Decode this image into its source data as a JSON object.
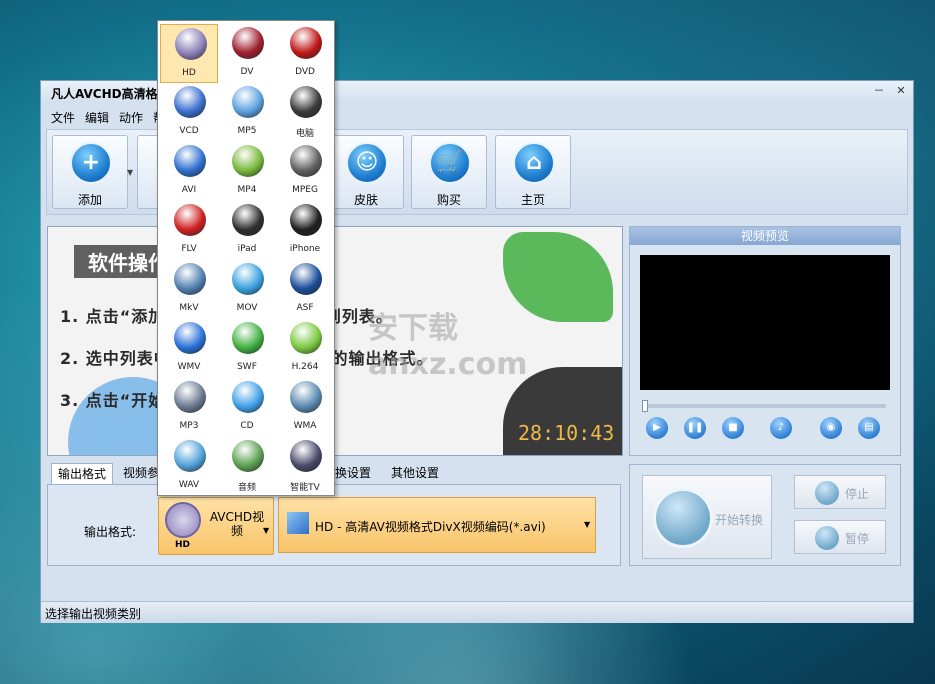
{
  "window": {
    "title": "凡人AVCHD高清格式",
    "min_glyph": "－",
    "close_glyph": "✕"
  },
  "menu": [
    "文件",
    "编辑",
    "动作",
    "帮"
  ],
  "toolbar": {
    "buttons": [
      {
        "label": "添加",
        "icon": "plus-icon",
        "glyph": "+"
      },
      {
        "label": "皮肤",
        "icon": "smiley-icon",
        "glyph": "☺"
      },
      {
        "label": "购买",
        "icon": "cart-icon",
        "glyph": "🛒"
      },
      {
        "label": "主页",
        "icon": "home-icon",
        "glyph": "⌂"
      }
    ]
  },
  "banner": {
    "title": "软件操作",
    "steps": [
      "1. 点击“添加          要转换的音视频文件到列表。",
      "2. 选中列表中          ” 选项框中更改当前的输出格式。",
      "3. 点击“开始          开始进行格式转换。"
    ],
    "watermark": "安下载 anxz.com",
    "clock": "28:10:43"
  },
  "preview": {
    "title": "视频预览",
    "seek_position": 0
  },
  "tabs": [
    "输出格式",
    "视频参",
    "换设置",
    "其他设置"
  ],
  "format": {
    "label": "输出格式:",
    "selected_button": {
      "icon_label": "HD",
      "text": "AVCHD视频"
    },
    "profile": "HD - 高清AV视频格式DivX视频编码(*.avi)",
    "arrow": "▼"
  },
  "actions": {
    "start": "开始转换",
    "stop": "停止",
    "pause": "暂停"
  },
  "status": "选择输出视频类别",
  "popup": {
    "items": [
      {
        "label": "HD",
        "color": "#8a7fb7"
      },
      {
        "label": "DV",
        "color": "#a02030"
      },
      {
        "label": "DVD",
        "color": "#c01818"
      },
      {
        "label": "VCD",
        "color": "#3a6fd0"
      },
      {
        "label": "MP5",
        "color": "#5aa0e0"
      },
      {
        "label": "电脑",
        "color": "#3a3a3a"
      },
      {
        "label": "AVI",
        "color": "#2f6fd0"
      },
      {
        "label": "MP4",
        "color": "#78b83a"
      },
      {
        "label": "MPEG",
        "color": "#606060"
      },
      {
        "label": "FLV",
        "color": "#d02020"
      },
      {
        "label": "iPad",
        "color": "#303030"
      },
      {
        "label": "iPhone",
        "color": "#202020"
      },
      {
        "label": "MkV",
        "color": "#5080b0"
      },
      {
        "label": "MOV",
        "color": "#3aa0e0"
      },
      {
        "label": "ASF",
        "color": "#1a4f9a"
      },
      {
        "label": "WMV",
        "color": "#2a70d8"
      },
      {
        "label": "SWF",
        "color": "#40b040"
      },
      {
        "label": "H.264",
        "color": "#7ac840"
      },
      {
        "label": "MP3",
        "color": "#6a7a90"
      },
      {
        "label": "CD",
        "color": "#40a0e8"
      },
      {
        "label": "WMA",
        "color": "#5a8ab0"
      },
      {
        "label": "WAV",
        "color": "#50a0d8"
      },
      {
        "label": "音频",
        "color": "#5aa050"
      },
      {
        "label": "智能TV",
        "color": "#4a4a6a"
      }
    ]
  }
}
